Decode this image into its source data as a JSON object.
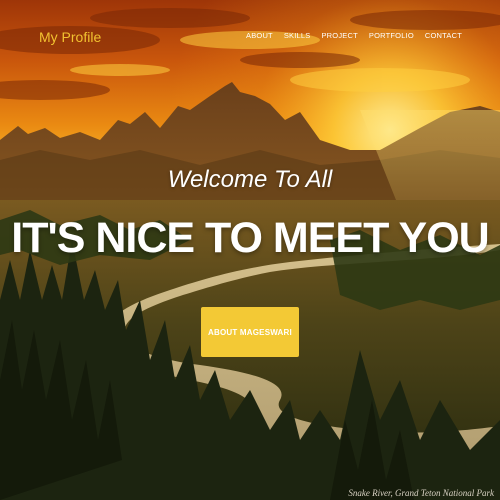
{
  "nav": {
    "brand": "My Profile",
    "links": [
      "ABOUT",
      "SKILLS",
      "PROJECT",
      "PORTFOLIO",
      "CONTACT"
    ]
  },
  "hero": {
    "subtitle": "Welcome To All",
    "title": "IT'S NICE TO MEET YOU",
    "cta_label": "ABOUT MAGESWARI",
    "photo_credit": "Snake River, Grand Teton National Park"
  },
  "colors": {
    "accent": "#f3c935",
    "brand_text": "#f2c230",
    "sky_top": "#b8400a",
    "sky_glow": "#ffd23a",
    "forest": "#1b2410"
  }
}
